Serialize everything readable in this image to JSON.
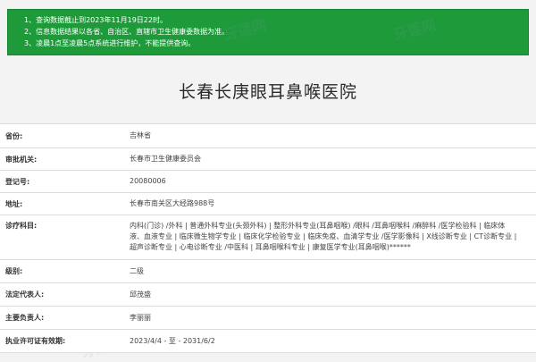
{
  "notice": {
    "lines": [
      "1、查询数据截止到2023年11月19日22时。",
      "2、信息数据结果以各省、自治区、直辖市卫生健康委数据为准。",
      "3、凌晨1点至凌晨5点系统进行维护，不能提供查询。"
    ]
  },
  "title": "长春长庚眼耳鼻喉医院",
  "watermark": "牙莲网",
  "rows": [
    {
      "label": "省份:",
      "value": "吉林省"
    },
    {
      "label": "审批机关:",
      "value": "长春市卫生健康委员会"
    },
    {
      "label": "登记号:",
      "value": "20080006"
    },
    {
      "label": "地址:",
      "value": "长春市南关区大经路988号"
    },
    {
      "label": "诊疗科目:",
      "value": "内科(门诊) /外科 | 普通外科专业(头颈外科) | 整形外科专业(耳鼻咽喉) /眼科 /耳鼻咽喉科 /麻醉科 /医学检验科 | 临床体液、血液专业 | 临床微生物学专业 | 临床化学检验专业 | 临床免疫、血清学专业 /医学影像科 | X线诊断专业 | CT诊断专业 | 超声诊断专业 | 心电诊断专业 /中医科 | 耳鼻咽喉科专业 | 康复医学专业(耳鼻咽喉)******"
    },
    {
      "label": "级别:",
      "value": "二级"
    },
    {
      "label": "法定代表人:",
      "value": "邱茂盛"
    },
    {
      "label": "主要负责人:",
      "value": "李丽丽"
    },
    {
      "label": "执业许可证有效期:",
      "value": "2023/4/4 - 至 - 2031/6/2"
    }
  ]
}
